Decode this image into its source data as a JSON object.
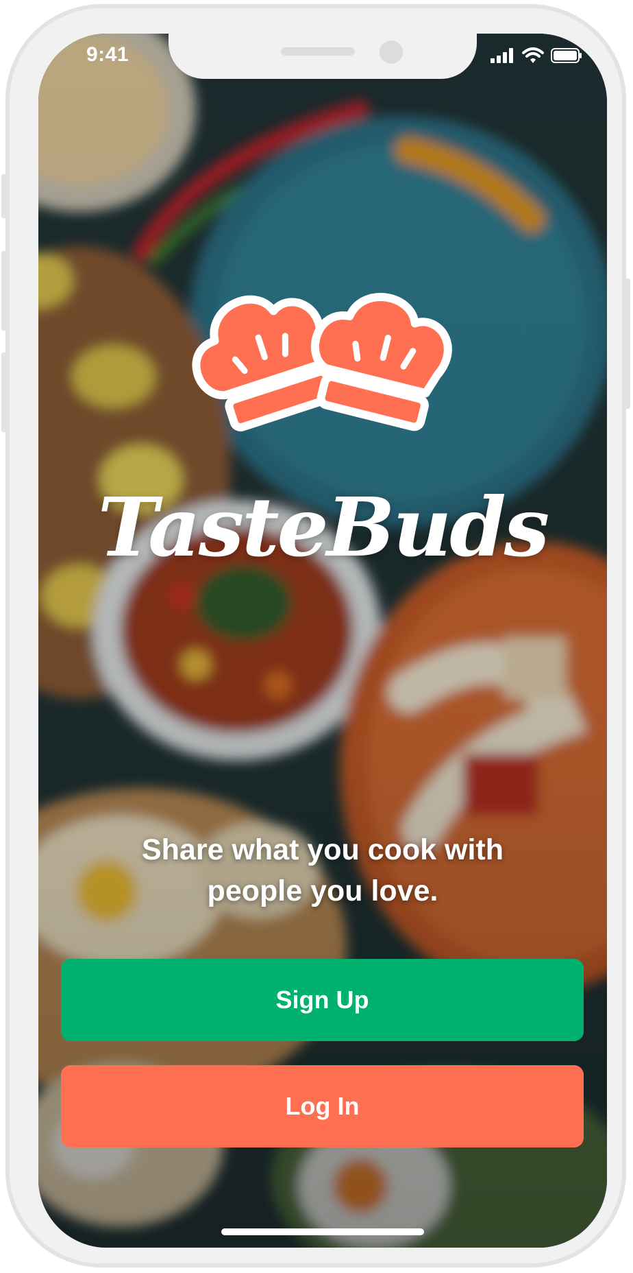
{
  "status_bar": {
    "time": "9:41",
    "icons": [
      "signal-icon",
      "wifi-icon",
      "battery-icon"
    ]
  },
  "brand": {
    "name": "TasteBuds",
    "logo_icon": "chef-hats-icon",
    "logo_color": "#ff6f52"
  },
  "tagline": "Share what you cook with people you love.",
  "buttons": {
    "signup_label": "Sign Up",
    "login_label": "Log In"
  },
  "colors": {
    "signup": "#00b06e",
    "login": "#ff6f52"
  }
}
